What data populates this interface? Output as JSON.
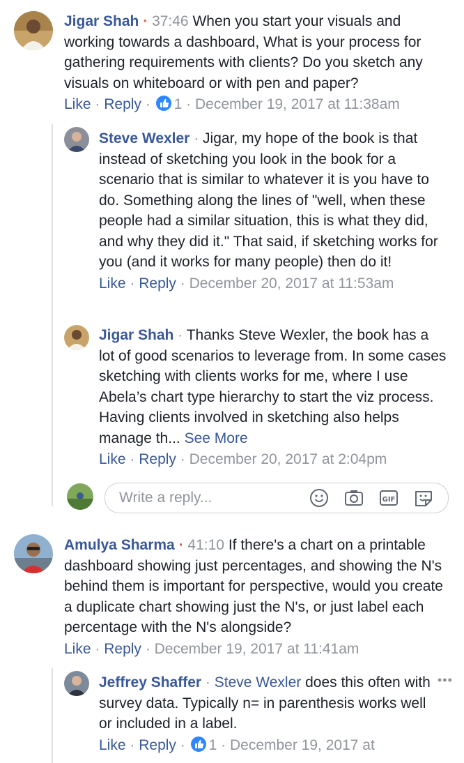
{
  "comments": [
    {
      "author": "Jigar Shah",
      "timestamp": "37:46",
      "text": "When you start your visuals and working towards a dashboard, What is your process for gathering requirements with clients? Do you sketch any visuals on whiteboard or with pen and paper?",
      "like_label": "Like",
      "reply_label": "Reply",
      "reaction_count": "1",
      "date": "December 19, 2017 at 11:38am",
      "replies": [
        {
          "author": "Steve Wexler",
          "text": "Jigar, my hope of the book is that instead of sketching you look in the book for a scenario that is similar to whatever it is you have to do. Something along the lines of \"well, when these people had a similar situation, this is what they did, and why they did it.\" That said, if sketching works for you (and it works for many people) then do it!",
          "like_label": "Like",
          "reply_label": "Reply",
          "date": "December 20, 2017 at 11:53am"
        },
        {
          "author": "Jigar Shah",
          "text": "Thanks Steve Wexler, the book has a lot of good scenarios to leverage from. In some cases sketching with clients works for me, where I use Abela’s chart type hierarchy to start the viz process. Having clients involved in sketching also helps manage th...",
          "see_more": "See More",
          "like_label": "Like",
          "reply_label": "Reply",
          "date": "December 20, 2017 at 2:04pm"
        }
      ]
    },
    {
      "author": "Amulya Sharma",
      "timestamp": "41:10",
      "text": "If there's a chart on a printable dashboard showing just percentages, and showing the N's behind them is important for perspective, would you create a duplicate chart showing just the N's, or just label each percentage with the N's alongside?",
      "like_label": "Like",
      "reply_label": "Reply",
      "date": "December 19, 2017 at 11:41am",
      "replies": [
        {
          "author": "Jeffrey Shaffer",
          "mention": "Steve Wexler",
          "text": "does this often with survey data. Typically n= in parenthesis works well or included in a label.",
          "like_label": "Like",
          "reply_label": "Reply",
          "reaction_count": "1",
          "date": "December 19, 2017 at"
        }
      ]
    }
  ],
  "reply_box": {
    "placeholder": "Write a reply...",
    "icons": [
      "emoji-icon",
      "camera-icon",
      "gif-icon",
      "sticker-icon"
    ]
  },
  "colors": {
    "author": "#385898",
    "meta": "#90949c",
    "accent_dot": "#e9573f",
    "like_badge": "#2d88ff"
  }
}
